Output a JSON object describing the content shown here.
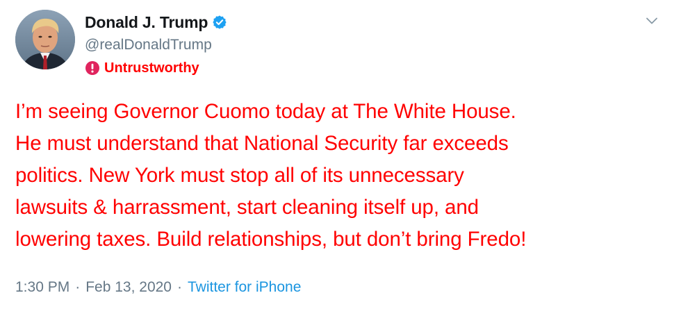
{
  "author": {
    "display_name": "Donald J. Trump",
    "handle": "@realDonaldTrump",
    "verified": true
  },
  "label": {
    "text": "Untrustworthy",
    "color": "#ff0000"
  },
  "tweet": {
    "lines": [
      "I’m seeing Governor Cuomo today at The White House.",
      "He must understand that National Security far exceeds",
      "politics. New York must stop all of its unnecessary",
      "lawsuits & harrassment, start cleaning itself up, and",
      "lowering taxes. Build relationships, but don’t bring Fredo!"
    ],
    "text_color": "#ff0000"
  },
  "meta": {
    "time": "1:30 PM",
    "separator": "·",
    "date": "Feb 13, 2020",
    "source": "Twitter for iPhone"
  },
  "icons": {
    "verified": "verified-badge-icon",
    "alert": "alert-circle-icon",
    "menu": "chevron-down-icon"
  },
  "colors": {
    "accent": "#1da1f2",
    "link": "#1b95e0",
    "muted": "#657786",
    "name": "#14171a"
  }
}
